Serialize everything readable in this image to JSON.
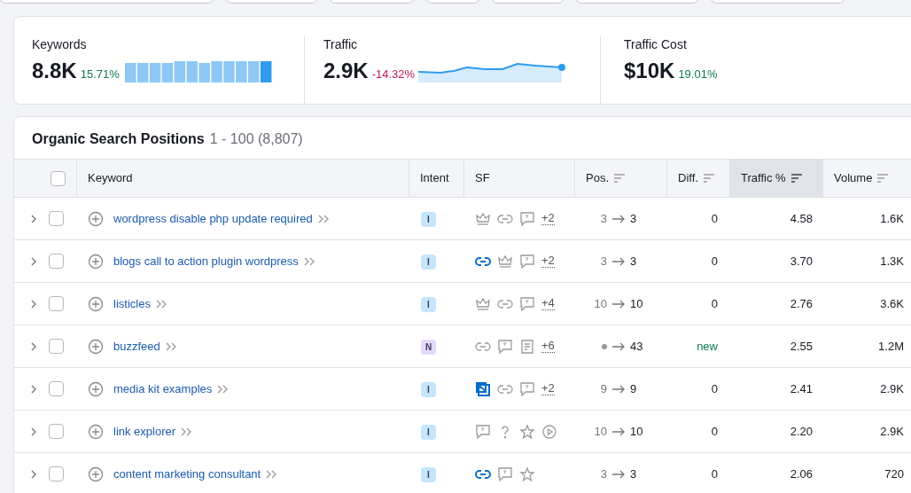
{
  "summary": [
    {
      "kind": "bars",
      "label": "Keywords",
      "value": "8.8K",
      "change": "15.71%",
      "color": "#0d7a55"
    },
    {
      "kind": "line",
      "label": "Traffic",
      "value": "2.9K",
      "change": "-14.32%",
      "color": "#c0174e"
    },
    {
      "kind": "none",
      "label": "Traffic Cost",
      "value": "$10K",
      "change": "19.01%",
      "color": "#0d7a55"
    }
  ],
  "table": {
    "title": "Organic Search Positions",
    "range": "1 - 100 (8,807)",
    "all_checked": false,
    "columns": [
      {
        "label": "Keyword",
        "sortable": false,
        "selected": false
      },
      {
        "label": "Intent",
        "sortable": false,
        "selected": false
      },
      {
        "label": "SF",
        "sortable": false,
        "selected": false
      },
      {
        "label": "Pos.",
        "sortable": true,
        "selected": false
      },
      {
        "label": "Diff.",
        "sortable": true,
        "selected": false
      },
      {
        "label": "Traffic %",
        "sortable": true,
        "selected": true
      },
      {
        "label": "Volume",
        "sortable": true,
        "selected": false
      }
    ],
    "rows": [
      {
        "keyword": "wordpress disable php update required",
        "checked": false,
        "intent": {
          "label": "I",
          "color": "#c4e5fb"
        },
        "sf": [
          {
            "kind": "crown",
            "active": false
          },
          {
            "kind": "link",
            "active": false
          },
          {
            "kind": "review",
            "active": false
          }
        ],
        "sf_more": "+2",
        "was_ranked": true,
        "from": "3",
        "to": "3",
        "diff": "0",
        "diff_new": false,
        "traffic": "4.58",
        "volume": "1.6K"
      },
      {
        "keyword": "blogs call to action plugin wordpress",
        "checked": false,
        "intent": {
          "label": "I",
          "color": "#c4e5fb"
        },
        "sf": [
          {
            "kind": "link",
            "active": true
          },
          {
            "kind": "crown",
            "active": false
          },
          {
            "kind": "review",
            "active": false
          }
        ],
        "sf_more": "+2",
        "was_ranked": true,
        "from": "3",
        "to": "3",
        "diff": "0",
        "diff_new": false,
        "traffic": "3.70",
        "volume": "1.3K"
      },
      {
        "keyword": "listicles",
        "checked": false,
        "intent": {
          "label": "I",
          "color": "#c4e5fb"
        },
        "sf": [
          {
            "kind": "crown",
            "active": false
          },
          {
            "kind": "link",
            "active": false
          },
          {
            "kind": "review",
            "active": false
          }
        ],
        "sf_more": "+4",
        "was_ranked": true,
        "from": "10",
        "to": "10",
        "diff": "0",
        "diff_new": false,
        "traffic": "2.76",
        "volume": "3.6K"
      },
      {
        "keyword": "buzzfeed",
        "checked": false,
        "intent": {
          "label": "N",
          "color": "#e5d9fb"
        },
        "sf": [
          {
            "kind": "link",
            "active": false
          },
          {
            "kind": "review",
            "active": false
          },
          {
            "kind": "article",
            "active": false
          }
        ],
        "sf_more": "+6",
        "was_ranked": false,
        "to": "43",
        "diff": "new",
        "diff_new": true,
        "traffic": "2.55",
        "volume": "1.2M"
      },
      {
        "keyword": "media kit examples",
        "checked": false,
        "intent": {
          "label": "I",
          "color": "#c4e5fb"
        },
        "sf": [
          {
            "kind": "image",
            "active": true
          },
          {
            "kind": "link",
            "active": false
          },
          {
            "kind": "review",
            "active": false
          }
        ],
        "sf_more": "+2",
        "was_ranked": true,
        "from": "9",
        "to": "9",
        "diff": "0",
        "diff_new": false,
        "traffic": "2.41",
        "volume": "2.9K"
      },
      {
        "keyword": "link explorer",
        "checked": false,
        "intent": {
          "label": "I",
          "color": "#c4e5fb"
        },
        "sf": [
          {
            "kind": "review",
            "active": false
          },
          {
            "kind": "question",
            "active": false
          },
          {
            "kind": "star",
            "active": false
          },
          {
            "kind": "video",
            "active": false
          }
        ],
        "was_ranked": true,
        "from": "10",
        "to": "10",
        "diff": "0",
        "diff_new": false,
        "traffic": "2.20",
        "volume": "2.9K"
      },
      {
        "keyword": "content marketing consultant",
        "checked": false,
        "intent": {
          "label": "I",
          "color": "#c4e5fb"
        },
        "sf": [
          {
            "kind": "link",
            "active": true
          },
          {
            "kind": "review",
            "active": false
          },
          {
            "kind": "star",
            "active": false
          }
        ],
        "was_ranked": true,
        "from": "3",
        "to": "3",
        "diff": "0",
        "diff_new": false,
        "traffic": "2.06",
        "volume": "720"
      }
    ]
  }
}
